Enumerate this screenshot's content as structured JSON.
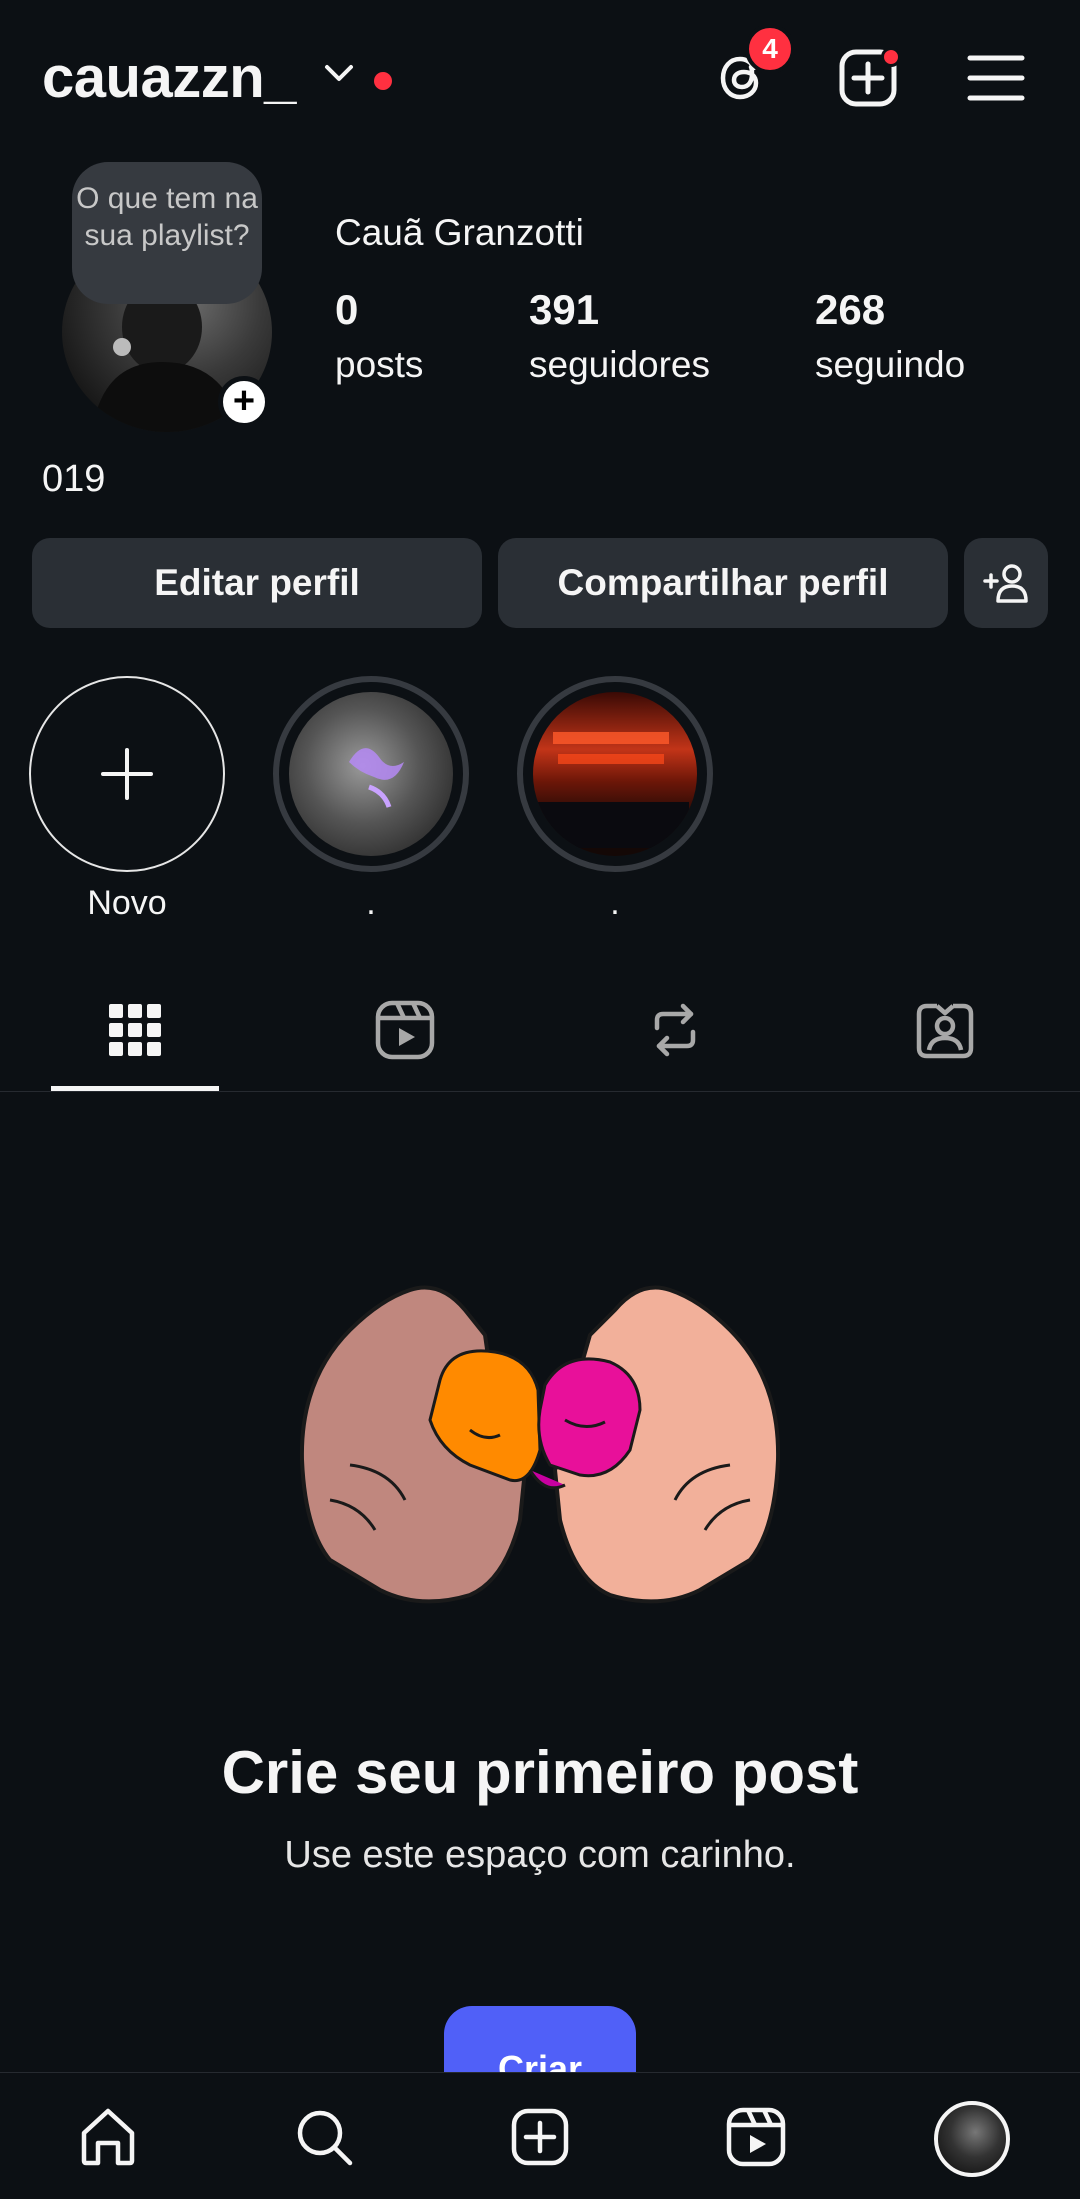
{
  "header": {
    "username": "cauazzn_",
    "threads_badge": "4",
    "icons": [
      "chevron-down-icon",
      "threads-icon",
      "add-post-icon",
      "menu-icon"
    ]
  },
  "profile": {
    "note": "O que tem na sua playlist?",
    "full_name": "Cauã Granzotti",
    "stats": [
      {
        "value": "0",
        "label": "posts"
      },
      {
        "value": "391",
        "label": "seguidores"
      },
      {
        "value": "268",
        "label": "seguindo"
      }
    ],
    "bio": "019"
  },
  "actions": {
    "edit_label": "Editar perfil",
    "share_label": "Compartilhar perfil"
  },
  "highlights": [
    {
      "label": "Novo"
    },
    {
      "label": "."
    },
    {
      "label": "."
    }
  ],
  "tabs": [
    "grid-icon",
    "reels-icon",
    "reposts-icon",
    "tagged-icon"
  ],
  "empty_state": {
    "title": "Crie seu primeiro post",
    "subtitle": "Use este espaço com carinho.",
    "button_label": "Criar"
  },
  "bottom_nav": [
    "home-icon",
    "search-icon",
    "create-icon",
    "reels-icon",
    "profile-avatar"
  ],
  "colors": {
    "background": "#0c1014",
    "button": "#2a2f35",
    "accent": "#5060f8",
    "notification": "#ff3040"
  }
}
